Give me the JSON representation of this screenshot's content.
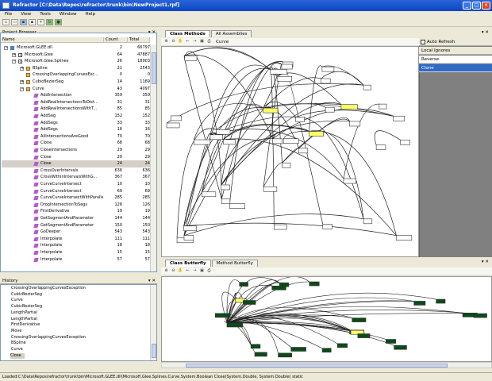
{
  "window": {
    "title": "Refractor [C:\\Data\\Repos\\refractor\\trunk\\bin\\NewProject1.rpf]"
  },
  "menu": [
    "File",
    "View",
    "Tools",
    "Window",
    "Help"
  ],
  "project_browser": {
    "title": "Project Browser",
    "columns": [
      "Name",
      "Count",
      "Total"
    ],
    "rows": [
      {
        "indent": 0,
        "exp": "−",
        "icon": "dll",
        "name": "Microsoft.GLEE.dll",
        "count": "2",
        "total": "66797"
      },
      {
        "indent": 1,
        "exp": "+",
        "icon": "ns",
        "name": "Microsoft.Glee",
        "count": "64",
        "total": "47887"
      },
      {
        "indent": 1,
        "exp": "−",
        "icon": "ns",
        "name": "Microsoft.Glee.Splines",
        "count": "26",
        "total": "18903"
      },
      {
        "indent": 2,
        "exp": "+",
        "icon": "cls",
        "name": "BSpline",
        "count": "21",
        "total": "2543"
      },
      {
        "indent": 2,
        "exp": "",
        "icon": "cls",
        "name": "CrossingOverlappingCurvesExc...",
        "count": "0",
        "total": "0"
      },
      {
        "indent": 2,
        "exp": "+",
        "icon": "cls",
        "name": "CubicBezierSeg",
        "count": "14",
        "total": "1169"
      },
      {
        "indent": 2,
        "exp": "−",
        "icon": "cls",
        "name": "Curve",
        "count": "43",
        "total": "4097"
      },
      {
        "indent": 3,
        "exp": "",
        "icon": "method",
        "name": "AddIntersection",
        "count": "359",
        "total": "359"
      },
      {
        "indent": 3,
        "exp": "",
        "icon": "method",
        "name": "AddRealIntersectionsToDist...",
        "count": "31",
        "total": "31"
      },
      {
        "indent": 3,
        "exp": "",
        "icon": "method",
        "name": "AddRealIntersectionsWithT...",
        "count": "85",
        "total": "85"
      },
      {
        "indent": 3,
        "exp": "",
        "icon": "method",
        "name": "AddSeg",
        "count": "152",
        "total": "152"
      },
      {
        "indent": 3,
        "exp": "",
        "icon": "method",
        "name": "AddSegs",
        "count": "33",
        "total": "33"
      },
      {
        "indent": 3,
        "exp": "",
        "icon": "method",
        "name": "AddSegs",
        "count": "16",
        "total": "16"
      },
      {
        "indent": 3,
        "exp": "",
        "icon": "method",
        "name": "AllIntersectionsAreGood",
        "count": "70",
        "total": "70"
      },
      {
        "indent": 3,
        "exp": "",
        "icon": "method",
        "name": "Clone",
        "count": "68",
        "total": "68"
      },
      {
        "indent": 3,
        "exp": "",
        "icon": "method",
        "name": "CloseIntersections",
        "count": "29",
        "total": "29"
      },
      {
        "indent": 3,
        "exp": "",
        "icon": "method",
        "name": "Close",
        "count": "29",
        "total": "29"
      },
      {
        "indent": 3,
        "exp": "",
        "icon": "method",
        "name": "Close",
        "count": "24",
        "total": "24",
        "selected": true
      },
      {
        "indent": 3,
        "exp": "",
        "icon": "method",
        "name": "CrossOverIntervals",
        "count": "636",
        "total": "636"
      },
      {
        "indent": 3,
        "exp": "",
        "icon": "method",
        "name": "CrossWithinIntervalsWithG...",
        "count": "367",
        "total": "367"
      },
      {
        "indent": 3,
        "exp": "",
        "icon": "method",
        "name": "CurveCurveIntersect",
        "count": "10",
        "total": "10"
      },
      {
        "indent": 3,
        "exp": "",
        "icon": "method",
        "name": "CurveCurveIntersect",
        "count": "69",
        "total": "69"
      },
      {
        "indent": 3,
        "exp": "",
        "icon": "method",
        "name": "CurveCurveIntersectWithParallelog...",
        "count": "285",
        "total": "285"
      },
      {
        "indent": 3,
        "exp": "",
        "icon": "method",
        "name": "DropIntersectionToSegs",
        "count": "126",
        "total": "126"
      },
      {
        "indent": 3,
        "exp": "",
        "icon": "method",
        "name": "FirstDerivative",
        "count": "19",
        "total": "19"
      },
      {
        "indent": 3,
        "exp": "",
        "icon": "method",
        "name": "GetSegmentAndParameter",
        "count": "144",
        "total": "144"
      },
      {
        "indent": 3,
        "exp": "",
        "icon": "method",
        "name": "GetSegmentAndParameter",
        "count": "150",
        "total": "150"
      },
      {
        "indent": 3,
        "exp": "",
        "icon": "method",
        "name": "GoDeeper",
        "count": "543",
        "total": "543"
      },
      {
        "indent": 3,
        "exp": "",
        "icon": "method",
        "name": "Interpolate",
        "count": "111",
        "total": "111"
      },
      {
        "indent": 3,
        "exp": "",
        "icon": "method",
        "name": "Interpolate",
        "count": "18",
        "total": "18"
      },
      {
        "indent": 3,
        "exp": "",
        "icon": "method",
        "name": "Interpolate",
        "count": "15",
        "total": "15"
      },
      {
        "indent": 3,
        "exp": "",
        "icon": "method",
        "name": "Interpolate",
        "count": "57",
        "total": "57"
      }
    ]
  },
  "history": {
    "title": "History",
    "items": [
      {
        "label": "CrossingOverlappingCurvesException"
      },
      {
        "label": "CubicBezierSeg"
      },
      {
        "label": "Curve"
      },
      {
        "label": "CubicBezierSeg"
      },
      {
        "label": "LengthPartial"
      },
      {
        "label": "LengthPartial"
      },
      {
        "label": "FirstDerivative"
      },
      {
        "label": "Move"
      },
      {
        "label": "CrossingOverlappingCurvesException"
      },
      {
        "label": "BSpline"
      },
      {
        "label": "Curve"
      },
      {
        "label": "Close",
        "selected": true
      }
    ]
  },
  "top_tabs": [
    {
      "label": "Class Methods",
      "active": true
    },
    {
      "label": "All Assemblies",
      "active": false
    }
  ],
  "graph_label": "Curve",
  "bottom_tabs": [
    {
      "label": "Class Butterfly",
      "active": true
    },
    {
      "label": "Method Butterfly",
      "active": false
    }
  ],
  "right_panel": {
    "auto_refresh": "Auto Refresh",
    "header": "Local Ignores",
    "items": [
      {
        "label": "Reverse",
        "selected": false
      },
      {
        "label": "Clone",
        "selected": true
      }
    ]
  },
  "status": "Loaded:C:\\Data\\Repos\\refractor\\trunk\\bin\\Microsoft.GLEE.dll\\Microsoft.Glee.Splines.Curve.System.Boolean Close(System.Double, System.Double) static"
}
